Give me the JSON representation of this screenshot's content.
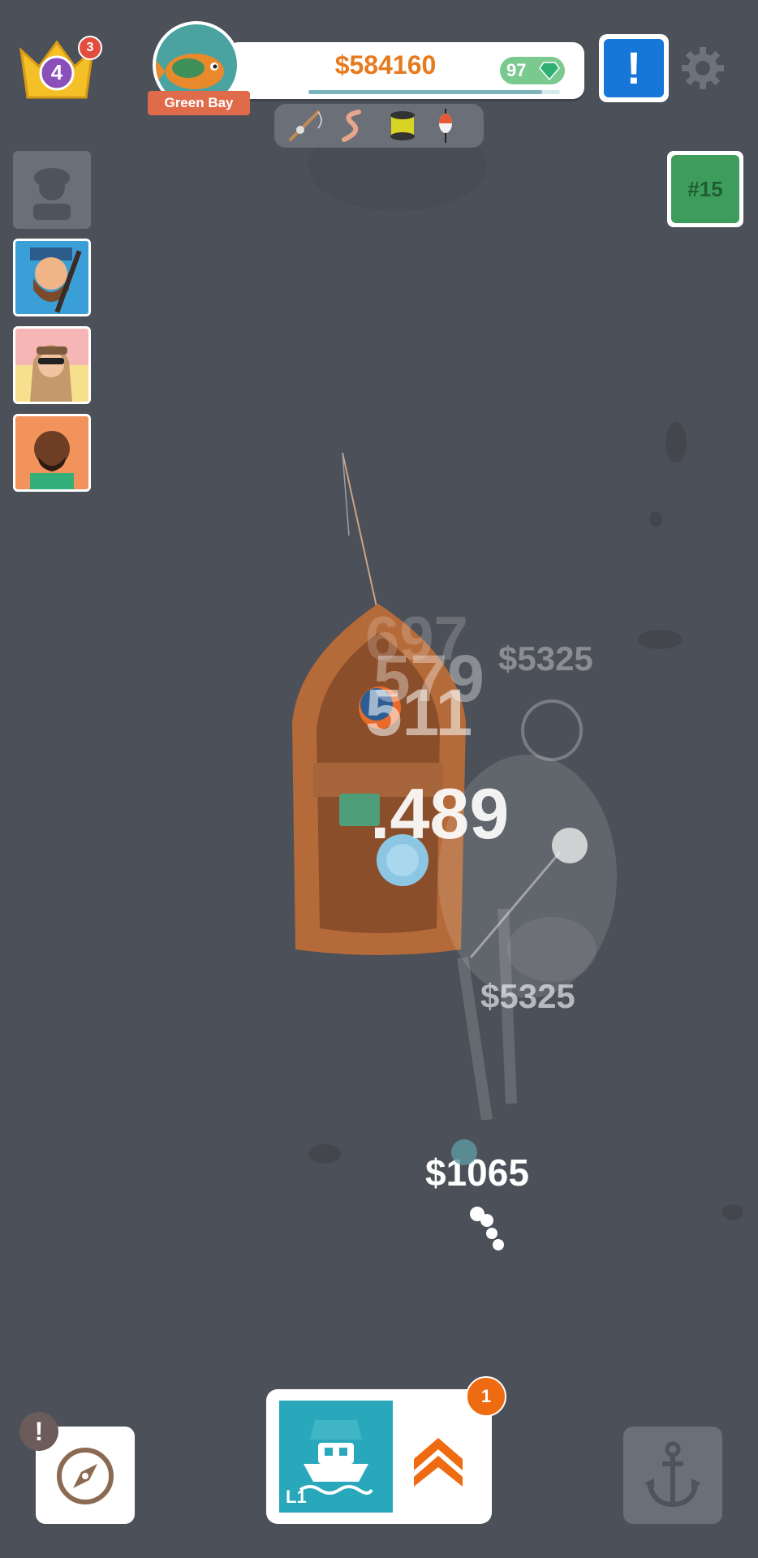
{
  "hud": {
    "crown_level": "4",
    "crown_badge": "3",
    "money": "$584160",
    "gems": "97",
    "xp_progress": 0.93,
    "location": "Green Bay",
    "level_tag": "#15",
    "alert_symbol": "!"
  },
  "floating_numbers": {
    "n1": "697",
    "n2": "579",
    "n3": "511",
    "n4": ".489",
    "money1": "$5325",
    "money2": "$5325",
    "money3": "$1065"
  },
  "bottom": {
    "compass_alert": "!",
    "boat_level": "L1",
    "upgrade_badge": "1"
  },
  "icons": [
    "crown-icon",
    "fish-icon",
    "gem-icon",
    "rod-icon",
    "worm-icon",
    "spool-icon",
    "bobber-icon",
    "gear-icon",
    "compass-icon",
    "boat-icon",
    "chevron-up-icon",
    "anchor-icon"
  ],
  "colors": {
    "water": "#4c5058",
    "money": "#e57a1e",
    "alert_blue": "#1677d9",
    "level_green": "#3e9d5c",
    "boat_teal": "#29a8bb",
    "upgrade_orange": "#ef6b12"
  }
}
